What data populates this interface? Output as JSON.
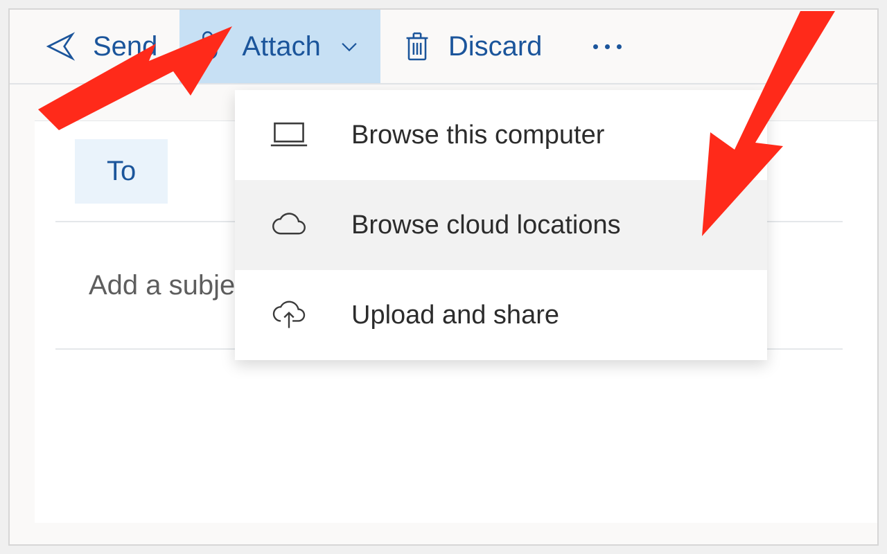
{
  "toolbar": {
    "send_label": "Send",
    "attach_label": "Attach",
    "discard_label": "Discard"
  },
  "compose": {
    "to_label": "To",
    "subject_placeholder": "Add a subject"
  },
  "attach_menu": {
    "items": [
      {
        "label": "Browse this computer"
      },
      {
        "label": "Browse cloud locations"
      },
      {
        "label": "Upload and share"
      }
    ]
  },
  "colors": {
    "accent": "#1b559b",
    "toolbar_active_bg": "#c7e0f4",
    "to_chip_bg": "#eaf3fb",
    "arrow": "#ff2a1a"
  }
}
